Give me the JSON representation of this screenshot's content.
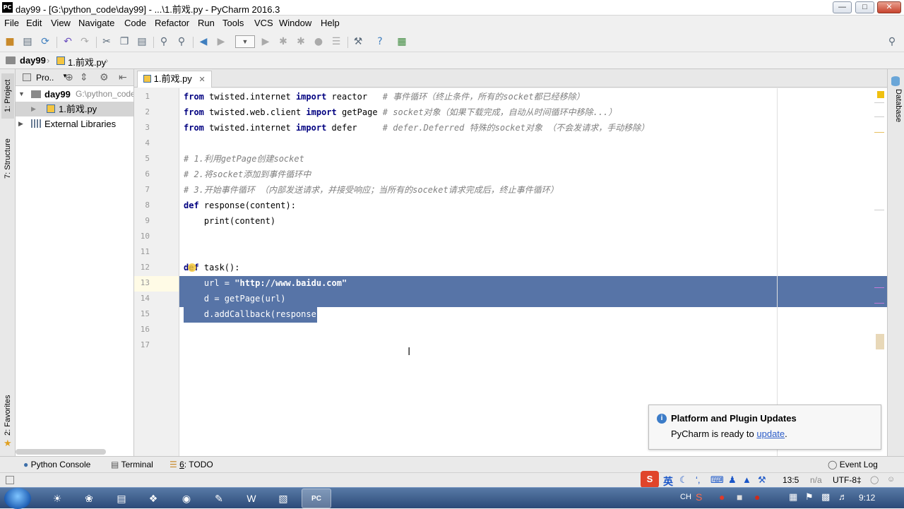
{
  "window": {
    "title": "day99 - [G:\\python_code\\day99] - ...\\1.前戏.py - PyCharm 2016.3",
    "app_icon": "PC"
  },
  "menu": [
    "File",
    "Edit",
    "View",
    "Navigate",
    "Code",
    "Refactor",
    "Run",
    "Tools",
    "VCS",
    "Window",
    "Help"
  ],
  "nav": {
    "project": "day99",
    "file": "1.前戏.py"
  },
  "project_panel": {
    "header_label": "Pro..",
    "root_name": "day99",
    "root_path": "G:\\python_code",
    "file_item": "1.前戏.py",
    "libraries": "External Libraries"
  },
  "left_tabs": {
    "project": "1: Project",
    "structure": "7: Structure",
    "favorites": "2: Favorites"
  },
  "right_tabs": {
    "database": "Database"
  },
  "editor": {
    "tab_label": "1.前戏.py",
    "line_numbers": [
      "1",
      "2",
      "3",
      "4",
      "5",
      "6",
      "7",
      "8",
      "9",
      "10",
      "11",
      "12",
      "13",
      "14",
      "15",
      "16",
      "17"
    ]
  },
  "code": {
    "l1_from": "from",
    "l1_mod": " twisted.internet ",
    "l1_imp": "import",
    "l1_name": " reactor   ",
    "l1_cm": "# 事件循环（终止条件，所有的socket都已经移除）",
    "l2_from": "from",
    "l2_mod": " twisted.web.client ",
    "l2_imp": "import",
    "l2_name": " getPage ",
    "l2_cm": "# socket对象（如果下载完成，自动从时间循环中移除...）",
    "l3_from": "from",
    "l3_mod": " twisted.internet ",
    "l3_imp": "import",
    "l3_name": " defer     ",
    "l3_cm": "# defer.Deferred 特殊的socket对象 （不会发请求，手动移除）",
    "l5": "# 1.利用getPage创建socket",
    "l6": "# 2.将socket添加到事件循环中",
    "l7": "# 3.开始事件循环 （内部发送请求，并接受响应；当所有的soceket请求完成后，终止事件循环）",
    "l8_def": "def",
    "l8_rest": " response(content):",
    "l9": "    print(content)",
    "l12_def": "def",
    "l12_rest": " task():",
    "l13_a": "    url = ",
    "l13_str": "\"http://www.baidu.com\"",
    "l14": "    d = getPage(url)",
    "l15": "    d.addCallback(response)"
  },
  "notification": {
    "title": "Platform and Plugin Updates",
    "message": "PyCharm is ready to ",
    "link": "update",
    "suffix": "."
  },
  "bottom_tabs": {
    "python_console": "Python Console",
    "terminal": "Terminal",
    "todo_num": "6",
    "todo": ": TODO",
    "event_log": "Event Log"
  },
  "status": {
    "position": "13:5",
    "na": "n/a",
    "encoding": "UTF-8‡"
  },
  "taskbar": {
    "lang": "CH",
    "time": "9:12",
    "ime": "英"
  },
  "colors": {
    "selection": "#5774a7",
    "keyword": "#000080",
    "comment": "#808080",
    "string": "#008000",
    "taskbar": "#2c4a78"
  }
}
